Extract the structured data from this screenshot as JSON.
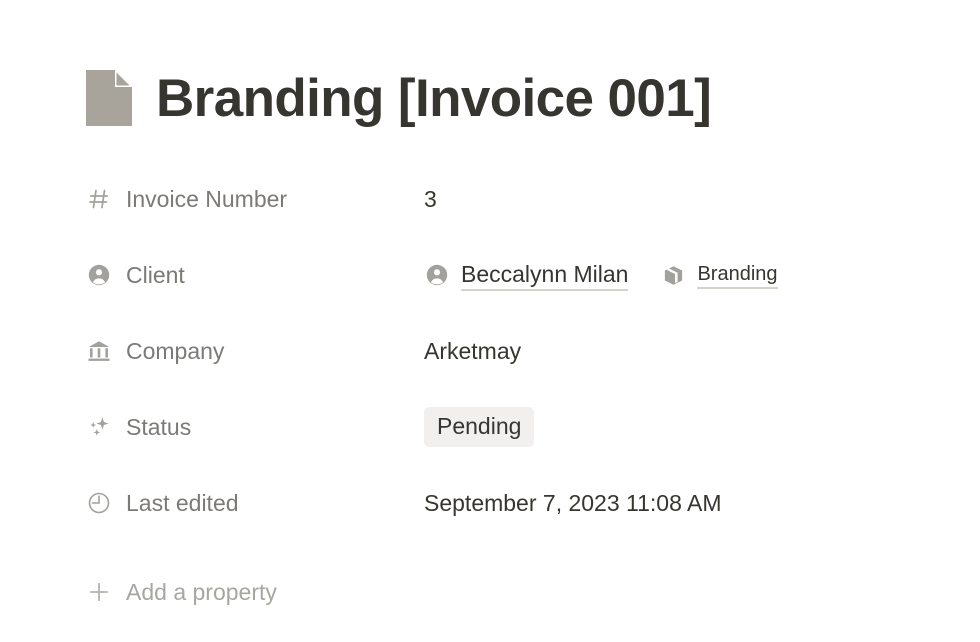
{
  "page": {
    "icon": "document-page-icon",
    "title": "Branding [Invoice 001]",
    "icon_color": "#a8a39b"
  },
  "properties": [
    {
      "icon": "hash-icon",
      "label": "Invoice Number",
      "value": "3",
      "type": "number"
    },
    {
      "icon": "person-circle-icon",
      "label": "Client",
      "type": "relation",
      "chips": [
        {
          "icon": "person-circle-icon",
          "text": "Beccalynn Milan"
        },
        {
          "icon": "cube-box-icon",
          "text": "Branding"
        }
      ]
    },
    {
      "icon": "bank-building-icon",
      "label": "Company",
      "value": "Arketmay",
      "type": "text"
    },
    {
      "icon": "sparkles-icon",
      "label": "Status",
      "value": "Pending",
      "type": "select",
      "badge_bg": "#f1f0ee",
      "badge_color": "#37352f"
    },
    {
      "icon": "clock-icon",
      "label": "Last edited",
      "value": "September 7, 2023 11:08 AM",
      "type": "date"
    }
  ],
  "add_property": {
    "icon": "plus-icon",
    "label": "Add a property"
  }
}
